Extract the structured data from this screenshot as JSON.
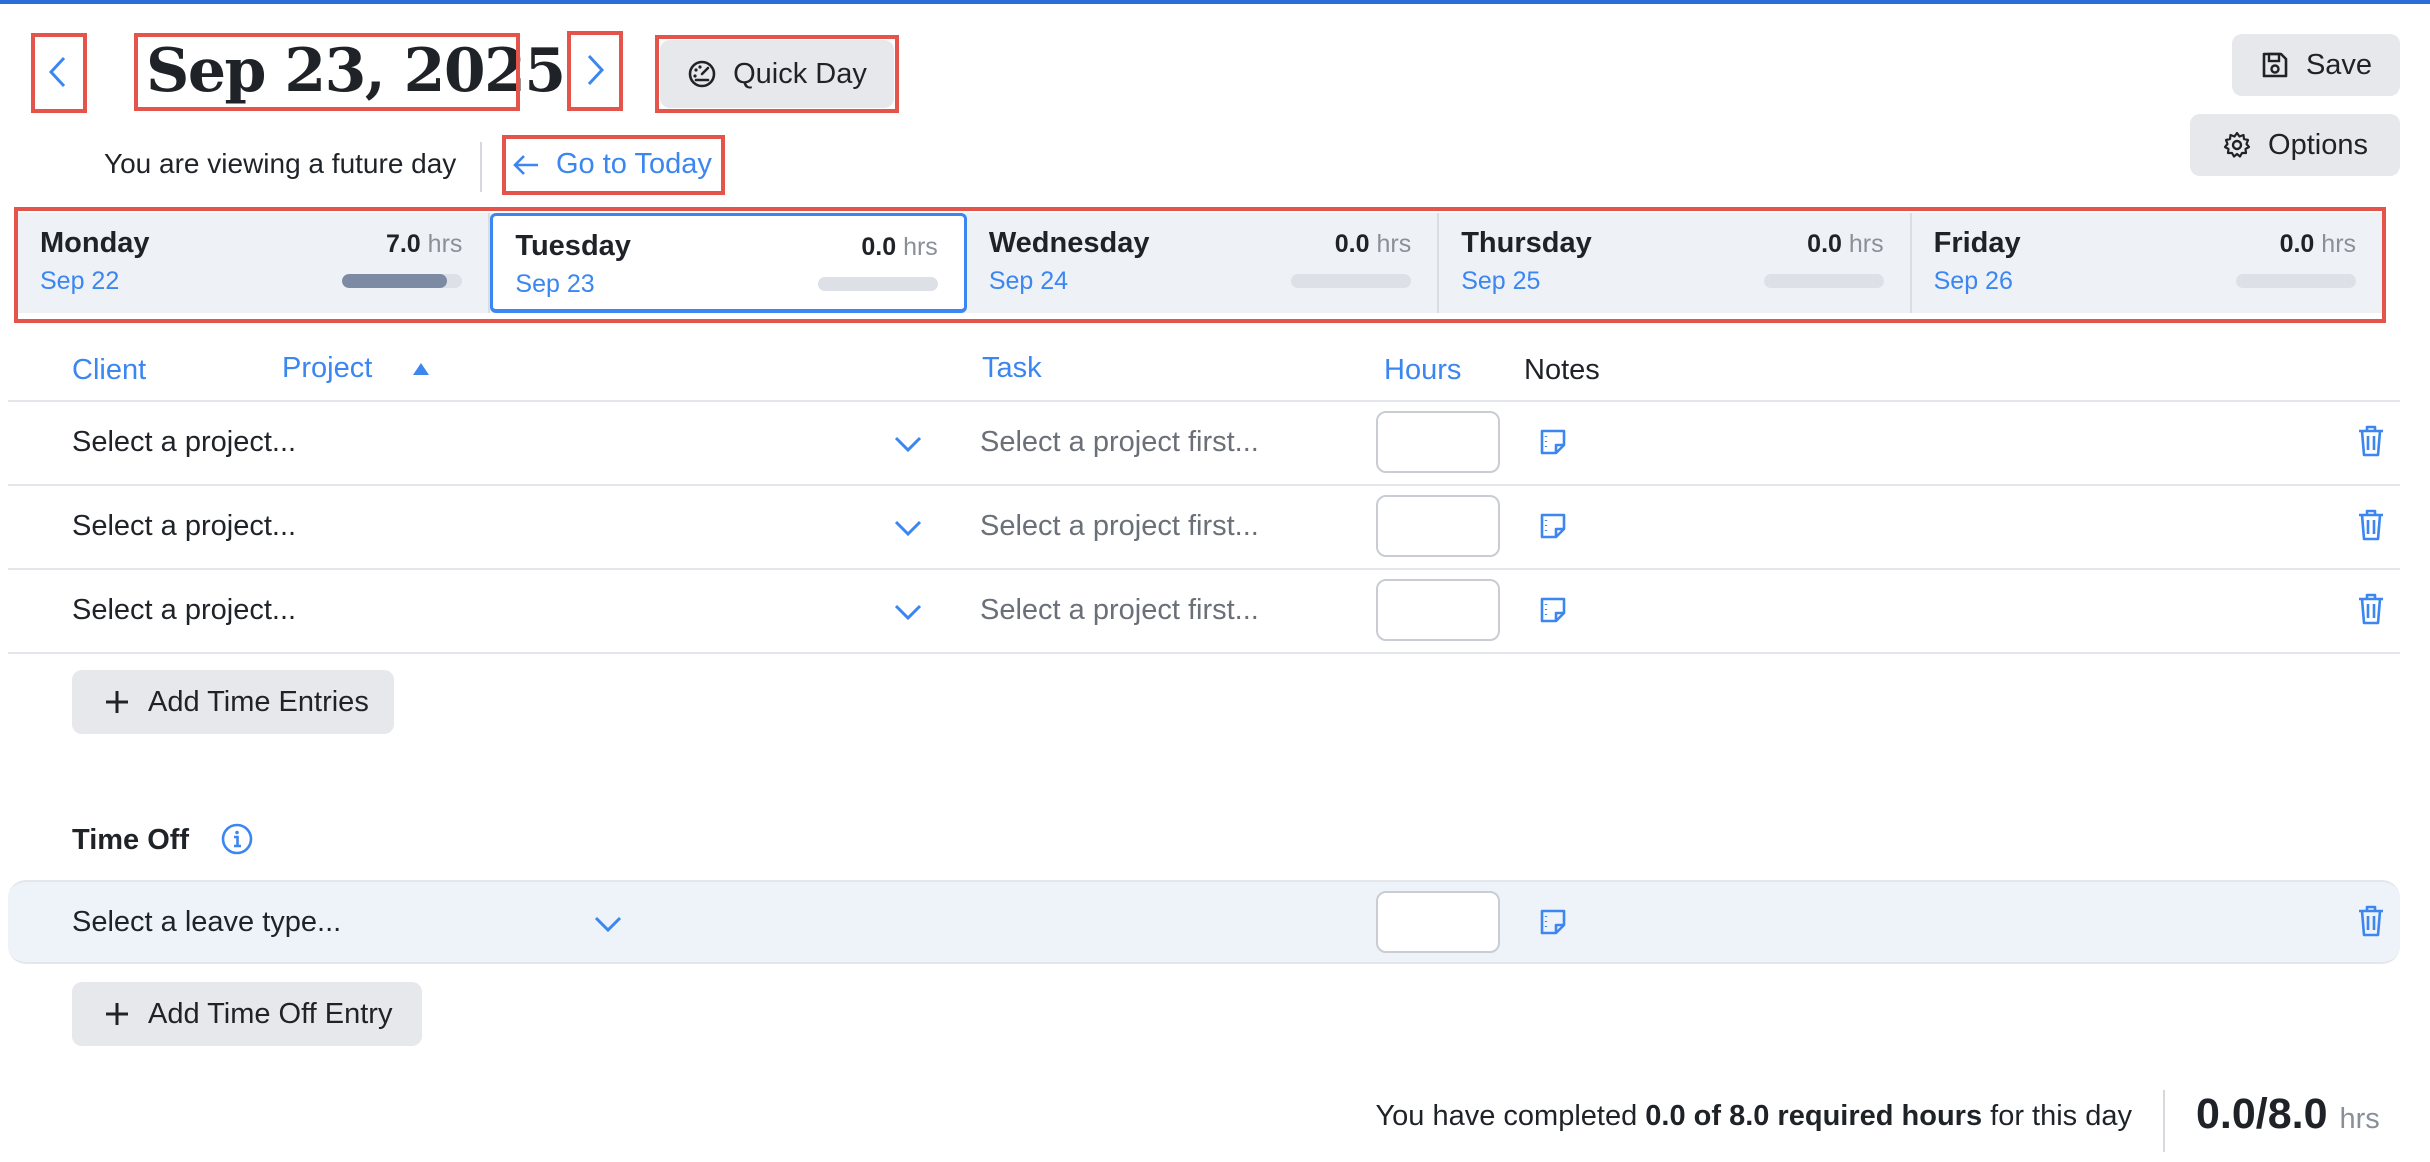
{
  "accent_color": "#3b86f0",
  "highlight_color": "#e5544b",
  "header": {
    "prev_icon": "chevron-left-icon",
    "next_icon": "chevron-right-icon",
    "date_title": "Sep 23, 2025",
    "quick_day_label": "Quick Day",
    "quick_day_icon": "speedometer-icon",
    "future_notice": "You are viewing a future day",
    "go_today_label": "Go to Today",
    "save_label": "Save",
    "options_label": "Options"
  },
  "days": [
    {
      "name": "Monday",
      "date": "Sep 22",
      "hours": "7.0",
      "unit": "hrs",
      "progress": 0.875,
      "active": false
    },
    {
      "name": "Tuesday",
      "date": "Sep 23",
      "hours": "0.0",
      "unit": "hrs",
      "progress": 0.0,
      "active": true
    },
    {
      "name": "Wednesday",
      "date": "Sep 24",
      "hours": "0.0",
      "unit": "hrs",
      "progress": 0.0,
      "active": false
    },
    {
      "name": "Thursday",
      "date": "Sep 25",
      "hours": "0.0",
      "unit": "hrs",
      "progress": 0.0,
      "active": false
    },
    {
      "name": "Friday",
      "date": "Sep 26",
      "hours": "0.0",
      "unit": "hrs",
      "progress": 0.0,
      "active": false
    }
  ],
  "table": {
    "columns": {
      "client": "Client",
      "project": "Project",
      "task": "Task",
      "hours": "Hours",
      "notes": "Notes"
    },
    "sort": {
      "column": "Project",
      "direction": "ascending"
    },
    "rows": [
      {
        "project_placeholder": "Select a project...",
        "task_placeholder": "Select a project first...",
        "hours": ""
      },
      {
        "project_placeholder": "Select a project...",
        "task_placeholder": "Select a project first...",
        "hours": ""
      },
      {
        "project_placeholder": "Select a project...",
        "task_placeholder": "Select a project first...",
        "hours": ""
      }
    ],
    "add_label": "Add Time Entries"
  },
  "time_off": {
    "title": "Time Off",
    "info_icon": "info-icon",
    "rows": [
      {
        "leave_placeholder": "Select a leave type...",
        "hours": ""
      }
    ],
    "add_label": "Add Time Off Entry"
  },
  "footer": {
    "prefix": "You have completed ",
    "bold": "0.0 of 8.0 required hours",
    "suffix": " for this day",
    "total": "0.0/8.0",
    "unit": "hrs"
  }
}
